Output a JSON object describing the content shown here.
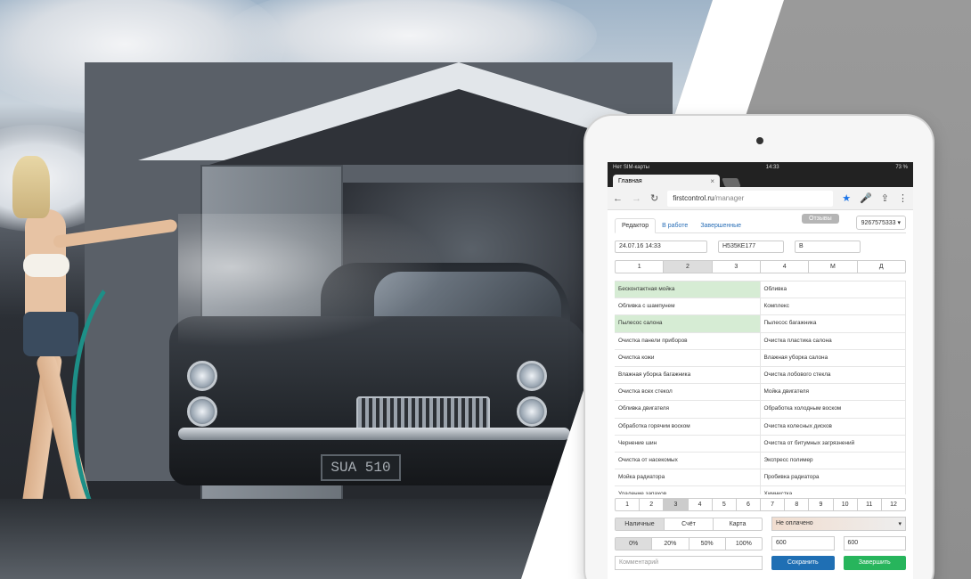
{
  "statusbar": {
    "carrier": "Нет SIM-карты",
    "time": "14:33",
    "battery": "73 %"
  },
  "browser": {
    "tab_title": "Главная",
    "tab_close": "×",
    "url_domain": "firstcontrol.ru",
    "url_path": "/manager"
  },
  "nav": {
    "tabs": [
      "Редактор",
      "В работе",
      "Завершенные"
    ],
    "reviews_label": "Отзывы",
    "phone": "9267575333"
  },
  "order": {
    "datetime": "24.07.16 14:33",
    "plate": "Н535КЕ177",
    "category": "В"
  },
  "sizes": {
    "items": [
      "1",
      "2",
      "3",
      "4",
      "М",
      "Д"
    ],
    "selected_index": 1
  },
  "services": {
    "left": [
      "Бесконтактная мойка",
      "Обливка с шампунем",
      "Пылесос салона",
      "Очистка панели приборов",
      "Очистка кожи",
      "Влажная уборка багажника",
      "Очистка всех стекол",
      "Обливка двигателя",
      "Обработка горячим воском",
      "Чернение шин",
      "Очистка от насекомых",
      "Мойка радиатора",
      "Удаление запахов"
    ],
    "right": [
      "Обливка",
      "Комплекс",
      "Пылесос багажника",
      "Очистка пластика салона",
      "Влажная уборка салона",
      "Очистка лобового стекла",
      "Мойка двигателя",
      "Обработка холодным воском",
      "Очистка колесных дисков",
      "Очистка от битумных загрязнений",
      "Экспресс полимер",
      "Пробивка радиатора",
      "Химчистка"
    ],
    "selected_left": [
      0,
      2
    ],
    "selected_right": []
  },
  "pager": {
    "items": [
      "1",
      "2",
      "3",
      "4",
      "5",
      "6",
      "7",
      "8",
      "9",
      "10",
      "11",
      "12"
    ],
    "selected_index": 2
  },
  "payment": {
    "methods": [
      "Наличные",
      "Счёт",
      "Карта"
    ],
    "selected_index": 0,
    "status": "Не оплачено"
  },
  "discounts": {
    "items": [
      "0%",
      "20%",
      "50%",
      "100%"
    ],
    "selected_index": 0,
    "amount_1": "600",
    "amount_2": "600"
  },
  "actions": {
    "comment_placeholder": "Комментарий",
    "save": "Сохранить",
    "finish": "Завершить"
  },
  "scene": {
    "license_plate_on_car": "SUA 510"
  }
}
